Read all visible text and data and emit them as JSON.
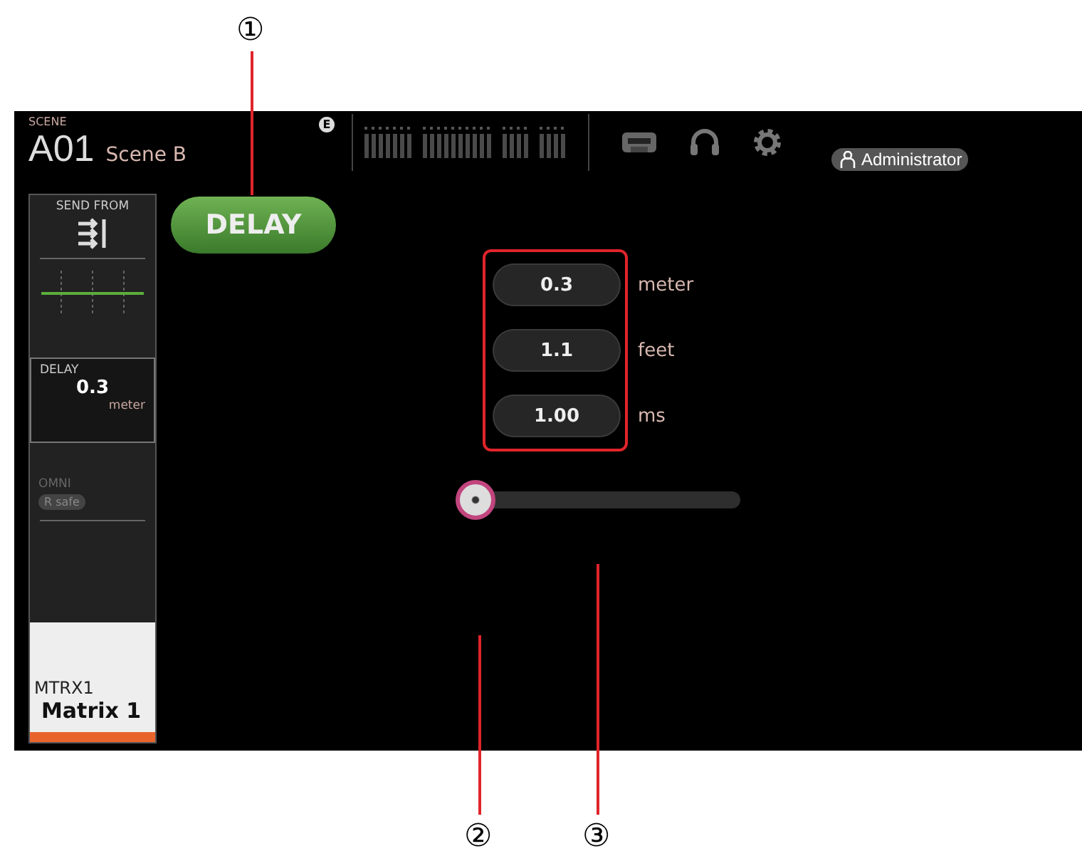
{
  "callouts": [
    {
      "label": "①"
    },
    {
      "label": "②"
    },
    {
      "label": "③"
    }
  ],
  "header": {
    "scene_label": "SCENE",
    "scene_number": "A01",
    "scene_name": "Scene B",
    "edit_badge": "E",
    "user": "Administrator"
  },
  "strip": {
    "send_from": "SEND FROM",
    "delay_label": "DELAY",
    "delay_value": "0.3",
    "delay_unit": "meter",
    "omni": "OMNI",
    "r_safe": "R safe",
    "channel_id": "MTRX1",
    "channel_name": "Matrix 1"
  },
  "delay_button": {
    "label": "DELAY",
    "on": true
  },
  "fields": [
    {
      "value": "0.3",
      "unit": "meter"
    },
    {
      "value": "1.1",
      "unit": "feet"
    },
    {
      "value": "1.00",
      "unit": "ms"
    }
  ],
  "slider": {
    "level": 0
  }
}
